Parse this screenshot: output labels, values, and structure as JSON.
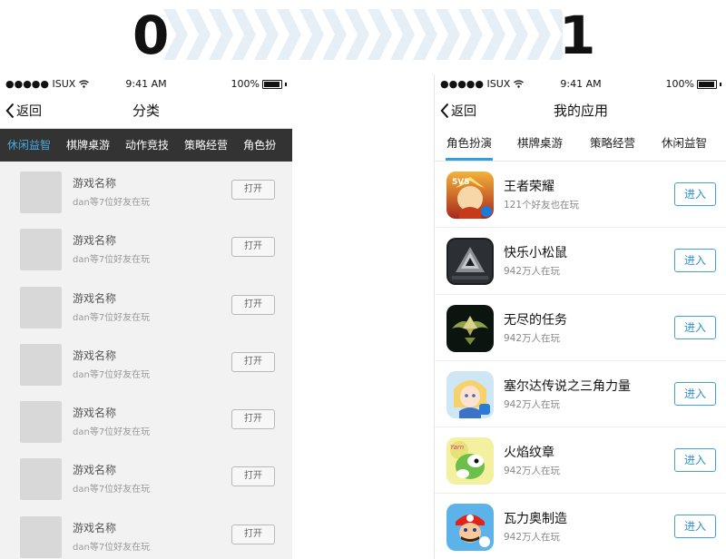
{
  "header": {
    "left_label": "0",
    "right_label": "1"
  },
  "status_bar": {
    "carrier": "●●●●● ISUX",
    "time": "9:41 AM",
    "battery": "100%"
  },
  "left_screen": {
    "back_label": "返回",
    "title": "分类",
    "tabs": [
      "休闲益智",
      "棋牌桌游",
      "动作竞技",
      "策略经营",
      "角色扮"
    ],
    "active_tab": 0,
    "items": [
      {
        "name": "游戏名称",
        "sub": "dan等7位好友在玩",
        "button": "打开"
      },
      {
        "name": "游戏名称",
        "sub": "dan等7位好友在玩",
        "button": "打开"
      },
      {
        "name": "游戏名称",
        "sub": "dan等7位好友在玩",
        "button": "打开"
      },
      {
        "name": "游戏名称",
        "sub": "dan等7位好友在玩",
        "button": "打开"
      },
      {
        "name": "游戏名称",
        "sub": "dan等7位好友在玩",
        "button": "打开"
      },
      {
        "name": "游戏名称",
        "sub": "dan等7位好友在玩",
        "button": "打开"
      },
      {
        "name": "游戏名称",
        "sub": "dan等7位好友在玩",
        "button": "打开"
      }
    ]
  },
  "right_screen": {
    "back_label": "返回",
    "title": "我的应用",
    "tabs": [
      "角色扮演",
      "棋牌桌游",
      "策略经营",
      "休闲益智"
    ],
    "active_tab": 0,
    "items": [
      {
        "name": "王者荣耀",
        "sub": "121个好友也在玩",
        "button": "进入",
        "icon": "honor-of-kings-icon"
      },
      {
        "name": "快乐小松鼠",
        "sub": "942万人在玩",
        "button": "进入",
        "icon": "dark-triangle-icon"
      },
      {
        "name": "无尽的任务",
        "sub": "942万人在玩",
        "button": "进入",
        "icon": "triforce-crest-icon"
      },
      {
        "name": "塞尔达传说之三角力量",
        "sub": "942万人在玩",
        "button": "进入",
        "icon": "anime-heroine-icon"
      },
      {
        "name": "火焰纹章",
        "sub": "942万人在玩",
        "button": "进入",
        "icon": "yoshi-icon"
      },
      {
        "name": "瓦力奥制造",
        "sub": "942万人在玩",
        "button": "进入",
        "icon": "mario-icon"
      }
    ]
  },
  "colors": {
    "accent": "#2fa0db",
    "dark_tab_bar": "#333333",
    "active_dark_tab": "#4aa8e0"
  }
}
